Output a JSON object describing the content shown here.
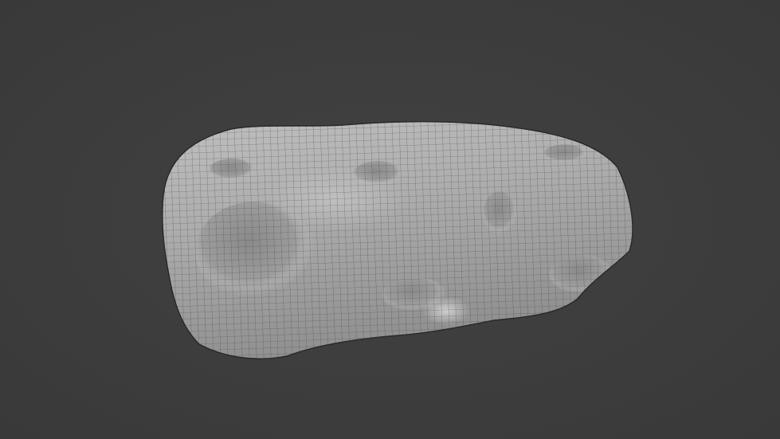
{
  "viewport": {
    "background_color": "#3d3d3d",
    "mesh_color": "#a9a9a9",
    "wire_color": "#3a3a3a"
  }
}
